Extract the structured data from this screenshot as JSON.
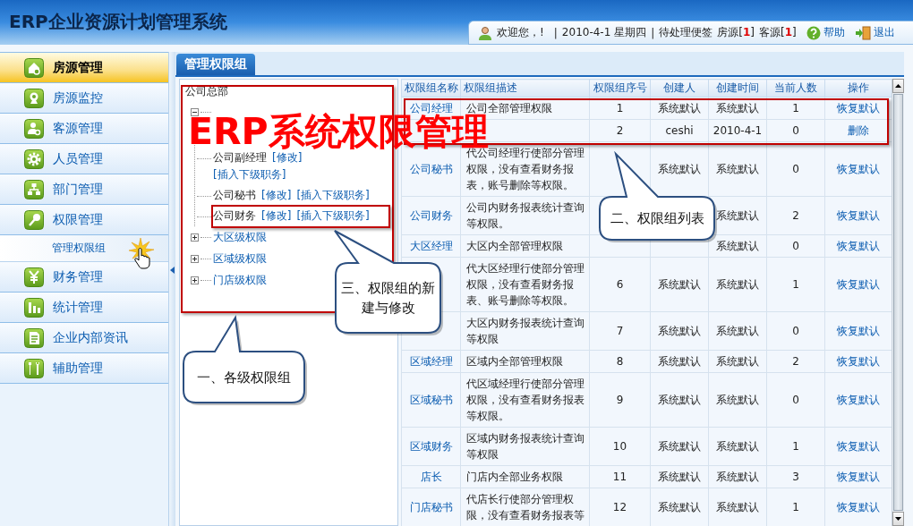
{
  "header": {
    "title": "ERP企业资源计划管理系统",
    "greeting": "欢迎您，!",
    "separator_1": "|",
    "date": "2010-4-1  星期四",
    "separator_2": "|",
    "notes_label": "待处理便签",
    "notes": [
      {
        "label": "房源[",
        "count": "1",
        "suffix": "]"
      },
      {
        "label": "客源[",
        "count": "1",
        "suffix": "]"
      }
    ],
    "help": "帮助",
    "logout": "退出"
  },
  "sidebar": {
    "items": [
      {
        "label": "房源管理",
        "selected": true
      },
      {
        "label": "房源监控",
        "selected": false
      },
      {
        "label": "客源管理",
        "selected": false
      },
      {
        "label": "人员管理",
        "selected": false
      },
      {
        "label": "部门管理",
        "selected": false
      },
      {
        "label": "权限管理",
        "selected": false,
        "children": [
          {
            "label": "管理权限组",
            "selected": false
          }
        ]
      },
      {
        "label": "财务管理",
        "selected": false
      },
      {
        "label": "统计管理",
        "selected": false
      },
      {
        "label": "企业内部资讯",
        "selected": false
      },
      {
        "label": "辅助管理",
        "selected": false
      }
    ]
  },
  "tabs": [
    {
      "label": "管理权限组",
      "selected": true
    }
  ],
  "tree": {
    "root": "公司总部",
    "groups": [
      {
        "expanded": true,
        "children": [
          {
            "name": "公司副经理",
            "actions": [
              "[修改]",
              "[插入下级职务]"
            ]
          },
          {
            "name": "公司秘书",
            "actions": [
              "[修改]",
              "[插入下级职务]"
            ]
          },
          {
            "name": "公司财务",
            "actions": [
              "[修改]",
              "[插入下级职务]"
            ]
          }
        ]
      },
      {
        "label": "大区级权限",
        "expanded": false
      },
      {
        "label": "区域级权限",
        "expanded": false
      },
      {
        "label": "门店级权限",
        "expanded": false
      }
    ]
  },
  "table": {
    "columns": [
      "权限组名称",
      "权限组描述",
      "权限组序号",
      "创建人",
      "创建时间",
      "当前人数",
      "操作"
    ],
    "rows": [
      {
        "name": "公司经理",
        "description": "公司全部管理权限",
        "order": "1",
        "creator": "系统默认",
        "created": "系统默认",
        "members": "1",
        "action": "恢复默认"
      },
      {
        "order": "2",
        "creator": "ceshi",
        "created": "2010-4-1",
        "members": "0",
        "action": "删除"
      },
      {
        "name": "公司秘书",
        "description": "代公司经理行使部分管理权限，没有查看财务报表，账号删除等权限。",
        "creator": "系统默认",
        "created": "系统默认",
        "members": "0",
        "action": "恢复默认"
      },
      {
        "name": "公司财务",
        "description": "公司内财务报表统计查询等权限。",
        "created": "系统默认",
        "members": "2",
        "action": "恢复默认"
      },
      {
        "name": "大区经理",
        "description": "大区内全部管理权限",
        "created": "系统默认",
        "members": "0",
        "action": "恢复默认"
      },
      {
        "description": "代大区经理行使部分管理权限，没有查看财务报表、账号删除等权限。",
        "order": "6",
        "creator": "系统默认",
        "created": "系统默认",
        "members": "1",
        "action": "恢复默认"
      },
      {
        "description": "大区内财务报表统计查询等权限",
        "order": "7",
        "creator": "系统默认",
        "created": "系统默认",
        "members": "0",
        "action": "恢复默认"
      },
      {
        "name": "区域经理",
        "description": "区域内全部管理权限",
        "order": "8",
        "creator": "系统默认",
        "created": "系统默认",
        "members": "2",
        "action": "恢复默认"
      },
      {
        "name": "区域秘书",
        "description": "代区域经理行使部分管理权限，没有查看财务报表等权限。",
        "order": "9",
        "creator": "系统默认",
        "created": "系统默认",
        "members": "0",
        "action": "恢复默认"
      },
      {
        "name": "区域财务",
        "description": "区域内财务报表统计查询等权限",
        "order": "10",
        "creator": "系统默认",
        "created": "系统默认",
        "members": "1",
        "action": "恢复默认"
      },
      {
        "name": "店长",
        "description": "门店内全部业务权限",
        "order": "11",
        "creator": "系统默认",
        "created": "系统默认",
        "members": "3",
        "action": "恢复默认"
      },
      {
        "name": "门店秘书",
        "description": "代店长行使部分管理权限，没有查看财务报表等",
        "order": "12",
        "creator": "系统默认",
        "created": "系统默认",
        "members": "1",
        "action": "恢复默认"
      }
    ]
  },
  "annotations": {
    "headline": "ERP系统权限管理",
    "callouts": [
      "一、各级权限组",
      "二、权限组列表",
      "三、权限组的新建与修改"
    ]
  }
}
